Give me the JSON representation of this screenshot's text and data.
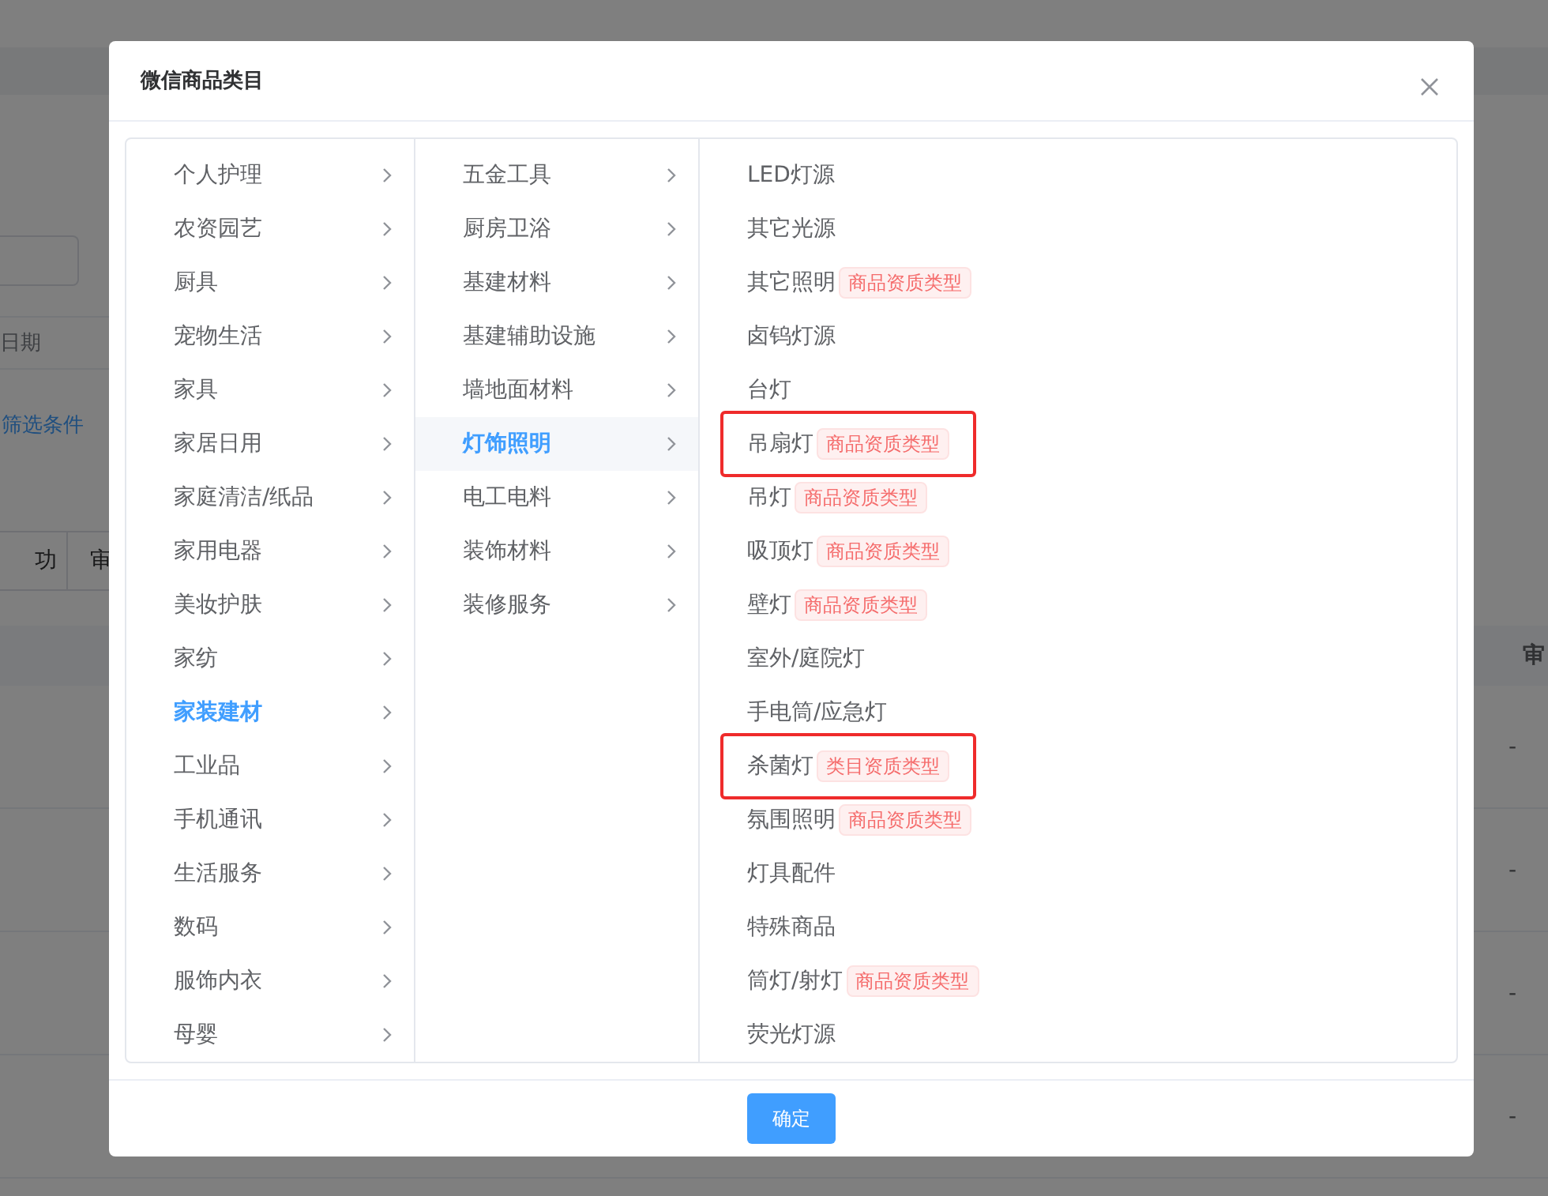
{
  "background": {
    "date_label": "日期",
    "filter_link": "筛选条件",
    "tabs": [
      "功",
      "审"
    ],
    "table_header": "审",
    "dashes": [
      "-",
      "-",
      "-",
      "-"
    ]
  },
  "dialog": {
    "title": "微信商品类目",
    "columns": [
      [
        {
          "label": "个人护理",
          "selected": false
        },
        {
          "label": "农资园艺",
          "selected": false
        },
        {
          "label": "厨具",
          "selected": false
        },
        {
          "label": "宠物生活",
          "selected": false
        },
        {
          "label": "家具",
          "selected": false
        },
        {
          "label": "家居日用",
          "selected": false
        },
        {
          "label": "家庭清洁/纸品",
          "selected": false
        },
        {
          "label": "家用电器",
          "selected": false
        },
        {
          "label": "美妆护肤",
          "selected": false
        },
        {
          "label": "家纺",
          "selected": false
        },
        {
          "label": "家装建材",
          "selected": true
        },
        {
          "label": "工业品",
          "selected": false
        },
        {
          "label": "手机通讯",
          "selected": false
        },
        {
          "label": "生活服务",
          "selected": false
        },
        {
          "label": "数码",
          "selected": false
        },
        {
          "label": "服饰内衣",
          "selected": false
        },
        {
          "label": "母婴",
          "selected": false
        }
      ],
      [
        {
          "label": "五金工具",
          "selected": false
        },
        {
          "label": "厨房卫浴",
          "selected": false
        },
        {
          "label": "基建材料",
          "selected": false
        },
        {
          "label": "基建辅助设施",
          "selected": false
        },
        {
          "label": "墙地面材料",
          "selected": false
        },
        {
          "label": "灯饰照明",
          "selected": true
        },
        {
          "label": "电工电料",
          "selected": false
        },
        {
          "label": "装饰材料",
          "selected": false
        },
        {
          "label": "装修服务",
          "selected": false
        }
      ]
    ],
    "leaves": [
      {
        "label": "LED灯源",
        "highlighted": false
      },
      {
        "label": "其它光源",
        "highlighted": false
      },
      {
        "label": "其它照明",
        "tag": "商品资质类型",
        "highlighted": false
      },
      {
        "label": "卤钨灯源",
        "highlighted": false
      },
      {
        "label": "台灯",
        "highlighted": false
      },
      {
        "label": "吊扇灯",
        "tag": "商品资质类型",
        "highlighted": true
      },
      {
        "label": "吊灯",
        "tag": "商品资质类型",
        "highlighted": false
      },
      {
        "label": "吸顶灯",
        "tag": "商品资质类型",
        "highlighted": false
      },
      {
        "label": "壁灯",
        "tag": "商品资质类型",
        "highlighted": false
      },
      {
        "label": "室外/庭院灯",
        "highlighted": false
      },
      {
        "label": "手电筒/应急灯",
        "highlighted": false
      },
      {
        "label": "杀菌灯",
        "tag": "类目资质类型",
        "highlighted": true
      },
      {
        "label": "氛围照明",
        "tag": "商品资质类型",
        "highlighted": false
      },
      {
        "label": "灯具配件",
        "highlighted": false
      },
      {
        "label": "特殊商品",
        "highlighted": false
      },
      {
        "label": "筒灯/射灯",
        "tag": "商品资质类型",
        "highlighted": false
      },
      {
        "label": "荧光灯源",
        "highlighted": false
      }
    ],
    "confirm_button": "确定"
  }
}
